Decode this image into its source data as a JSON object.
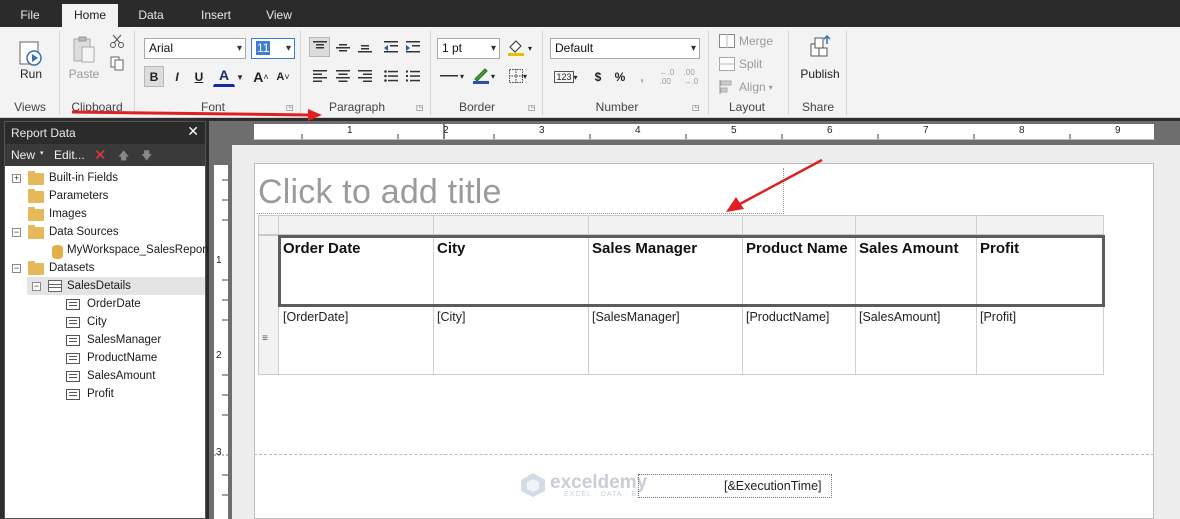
{
  "menu": {
    "tabs": [
      "File",
      "Home",
      "Data",
      "Insert",
      "View"
    ],
    "active": "Home"
  },
  "ribbon": {
    "groups": {
      "views": "Views",
      "clipboard": "Clipboard",
      "font": "Font",
      "paragraph": "Paragraph",
      "border": "Border",
      "number": "Number",
      "layout": "Layout",
      "share": "Share"
    },
    "run_label": "Run",
    "paste_label": "Paste",
    "font_name": "Arial",
    "font_size": "11",
    "border_width": "1 pt",
    "number_format": "Default",
    "merge_label": "Merge",
    "split_label": "Split",
    "align_label": "Align",
    "publish_label": "Publish",
    "bold": "B",
    "italic": "I",
    "underline": "U",
    "font_color": "A",
    "currency": "$",
    "percent": "%",
    "comma": ",",
    "placeholder_btn": "123"
  },
  "panel": {
    "title": "Report Data",
    "new_label": "New",
    "edit_label": "Edit...",
    "tree": {
      "builtin": "Built-in Fields",
      "parameters": "Parameters",
      "images": "Images",
      "data_sources": "Data Sources",
      "data_source_item": "MyWorkspace_SalesReport",
      "datasets": "Datasets",
      "dataset": "SalesDetails",
      "fields": [
        "OrderDate",
        "City",
        "SalesManager",
        "ProductName",
        "SalesAmount",
        "Profit"
      ]
    }
  },
  "ruler": {
    "top": [
      "1",
      "2",
      "3",
      "4",
      "5",
      "6",
      "7",
      "8",
      "9"
    ],
    "left": [
      "1",
      "2",
      "3"
    ]
  },
  "report": {
    "title_placeholder": "Click to add title",
    "headers": [
      "Order Date",
      "City",
      "Sales Manager",
      "Product Name",
      "Sales Amount",
      "Profit"
    ],
    "fields": [
      "[OrderDate]",
      "[City]",
      "[SalesManager]",
      "[ProductName]",
      "[SalesAmount]",
      "[Profit]"
    ],
    "execution_time": "[&ExecutionTime]"
  },
  "watermark": {
    "brand": "exceldemy",
    "tagline": "EXCEL · DATA · BI"
  },
  "colors": {
    "accent_arrow": "#e02020",
    "ribbon_bg": "#f3f3f3",
    "dark_chrome": "#2b2b2b"
  }
}
